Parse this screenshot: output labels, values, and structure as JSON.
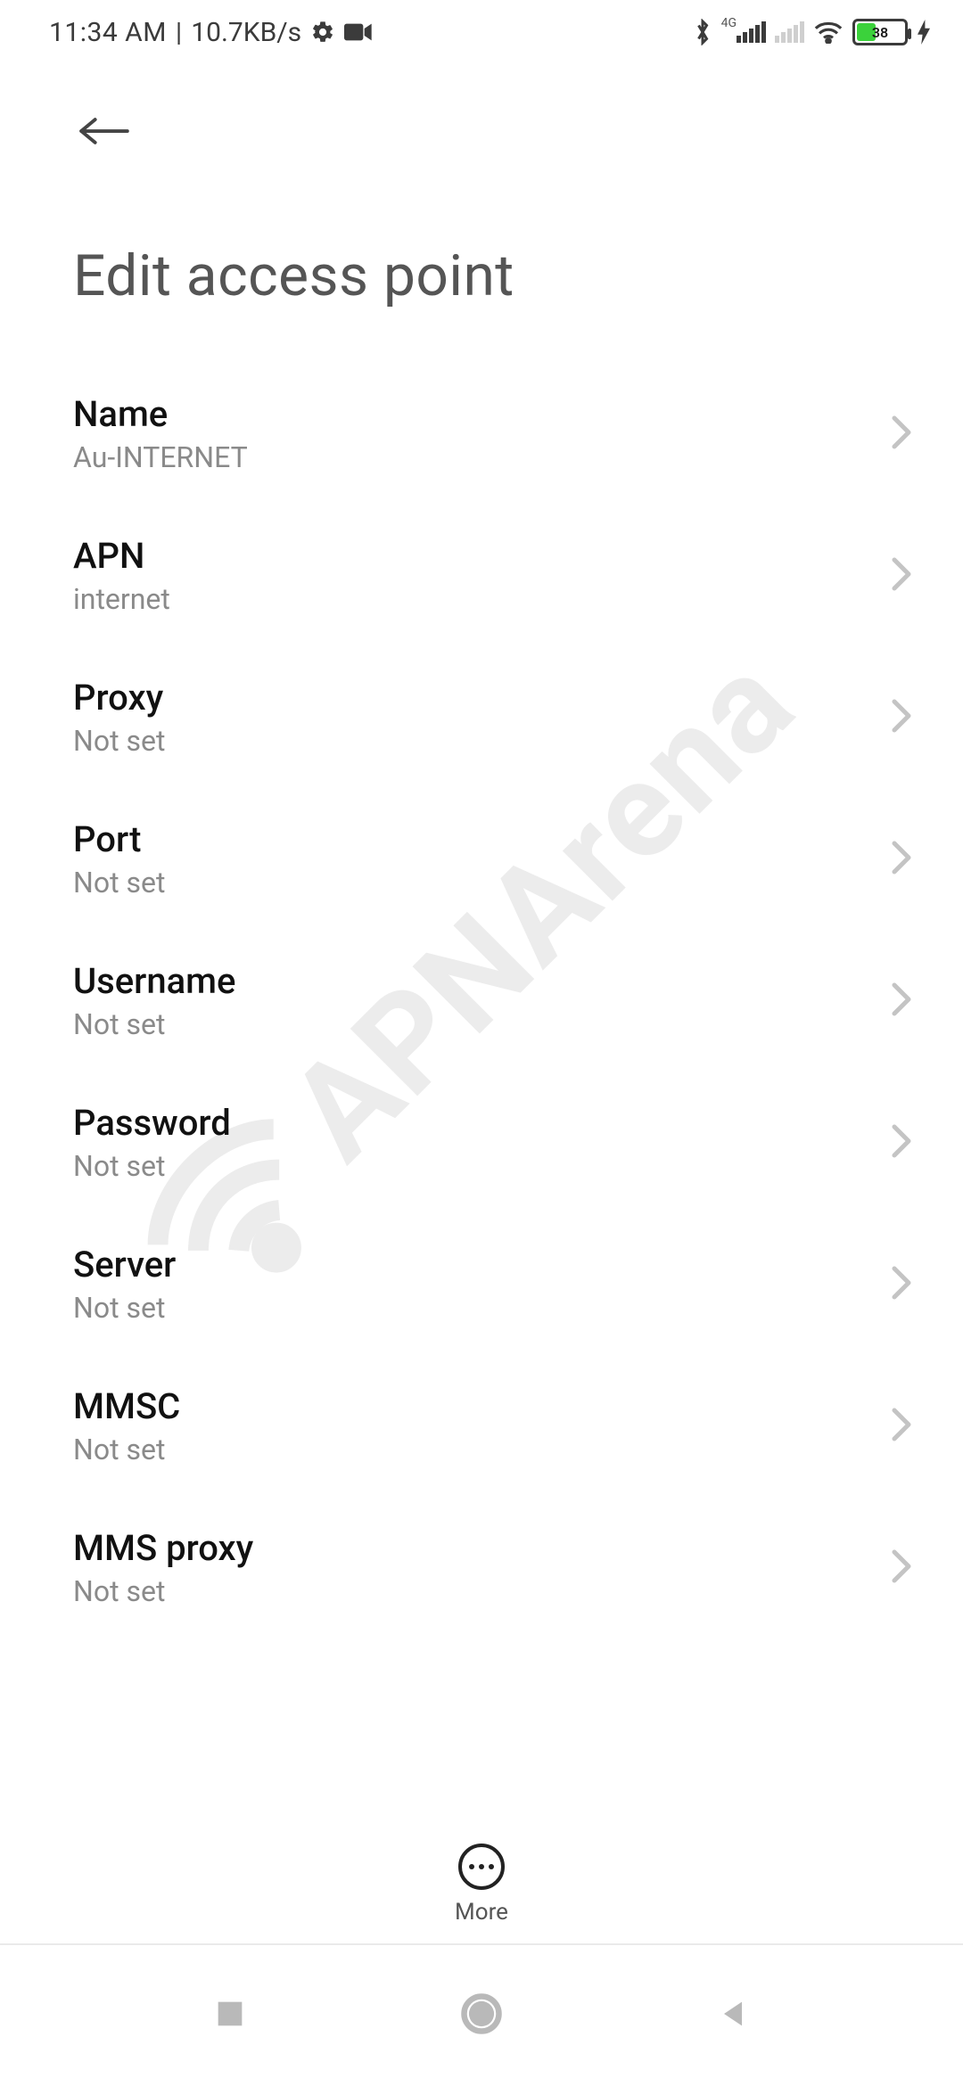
{
  "status": {
    "time": "11:34 AM",
    "separator": "|",
    "net_speed": "10.7KB/s",
    "network_tag": "4G",
    "battery_pct": "38"
  },
  "page_title": "Edit access point",
  "fields": [
    {
      "label": "Name",
      "value": "Au-INTERNET"
    },
    {
      "label": "APN",
      "value": "internet"
    },
    {
      "label": "Proxy",
      "value": "Not set"
    },
    {
      "label": "Port",
      "value": "Not set"
    },
    {
      "label": "Username",
      "value": "Not set"
    },
    {
      "label": "Password",
      "value": "Not set"
    },
    {
      "label": "Server",
      "value": "Not set"
    },
    {
      "label": "MMSC",
      "value": "Not set"
    },
    {
      "label": "MMS proxy",
      "value": "Not set"
    }
  ],
  "more_label": "More",
  "watermark_text": "APNArena"
}
